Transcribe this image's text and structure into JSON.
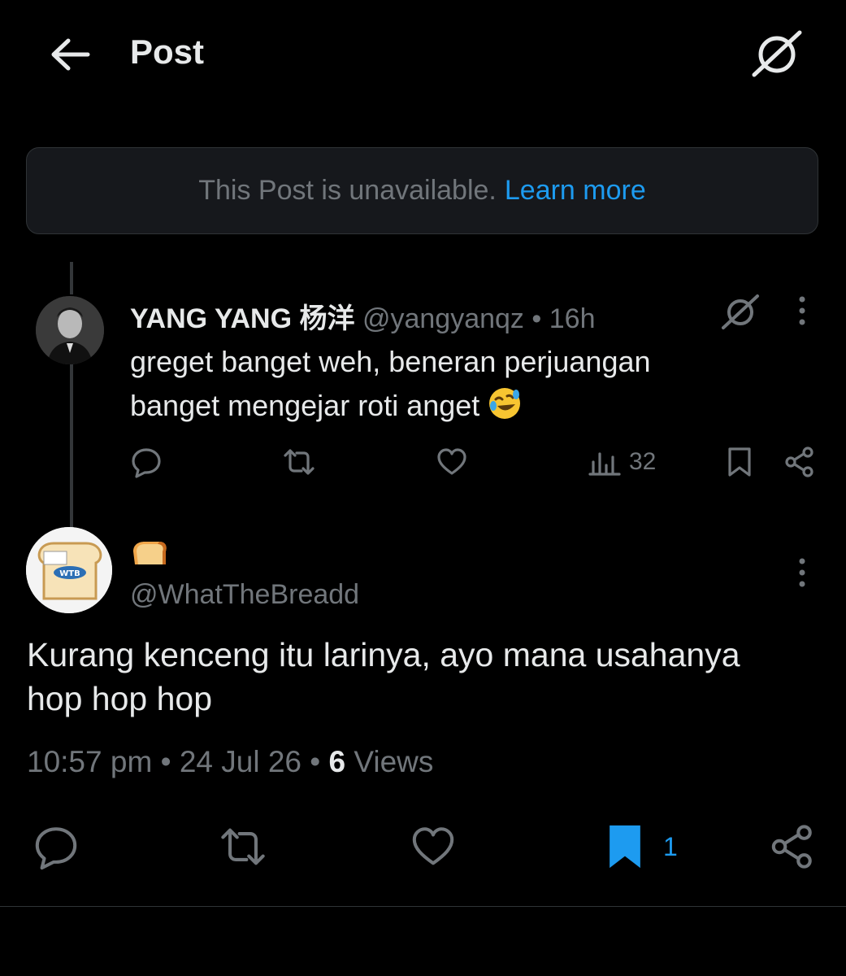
{
  "header": {
    "title": "Post",
    "back_icon": "arrow-left-icon",
    "grok_icon": "grok-icon"
  },
  "unavailable": {
    "text": "This Post is unavailable.",
    "link": "Learn more"
  },
  "reply": {
    "name": "YANG YANG 杨洋",
    "handle": "@yangyanqz",
    "dot": "•",
    "time": "16h",
    "text": "greget banget weh, beneran perjuangan banget mengejar roti anget",
    "emoji": "rolling-on-floor-laughing",
    "views": "32"
  },
  "post": {
    "display_name_emoji": "bread",
    "handle": "@WhatTheBreadd",
    "avatar_label": "WTB",
    "text_line1": "Kurang kenceng itu larinya, ayo mana usahanya",
    "text_line2": "hop hop hop",
    "time": "10:57 pm",
    "sep1": "•",
    "date": "24 Jul 26",
    "sep2": "•",
    "views_count": "6",
    "views_label": "Views",
    "bookmark_count": "1"
  },
  "colors": {
    "background": "#000000",
    "text": "#e7e9ea",
    "secondary": "#71767b",
    "accent": "#1d9bf0",
    "divider": "#2f3336"
  }
}
